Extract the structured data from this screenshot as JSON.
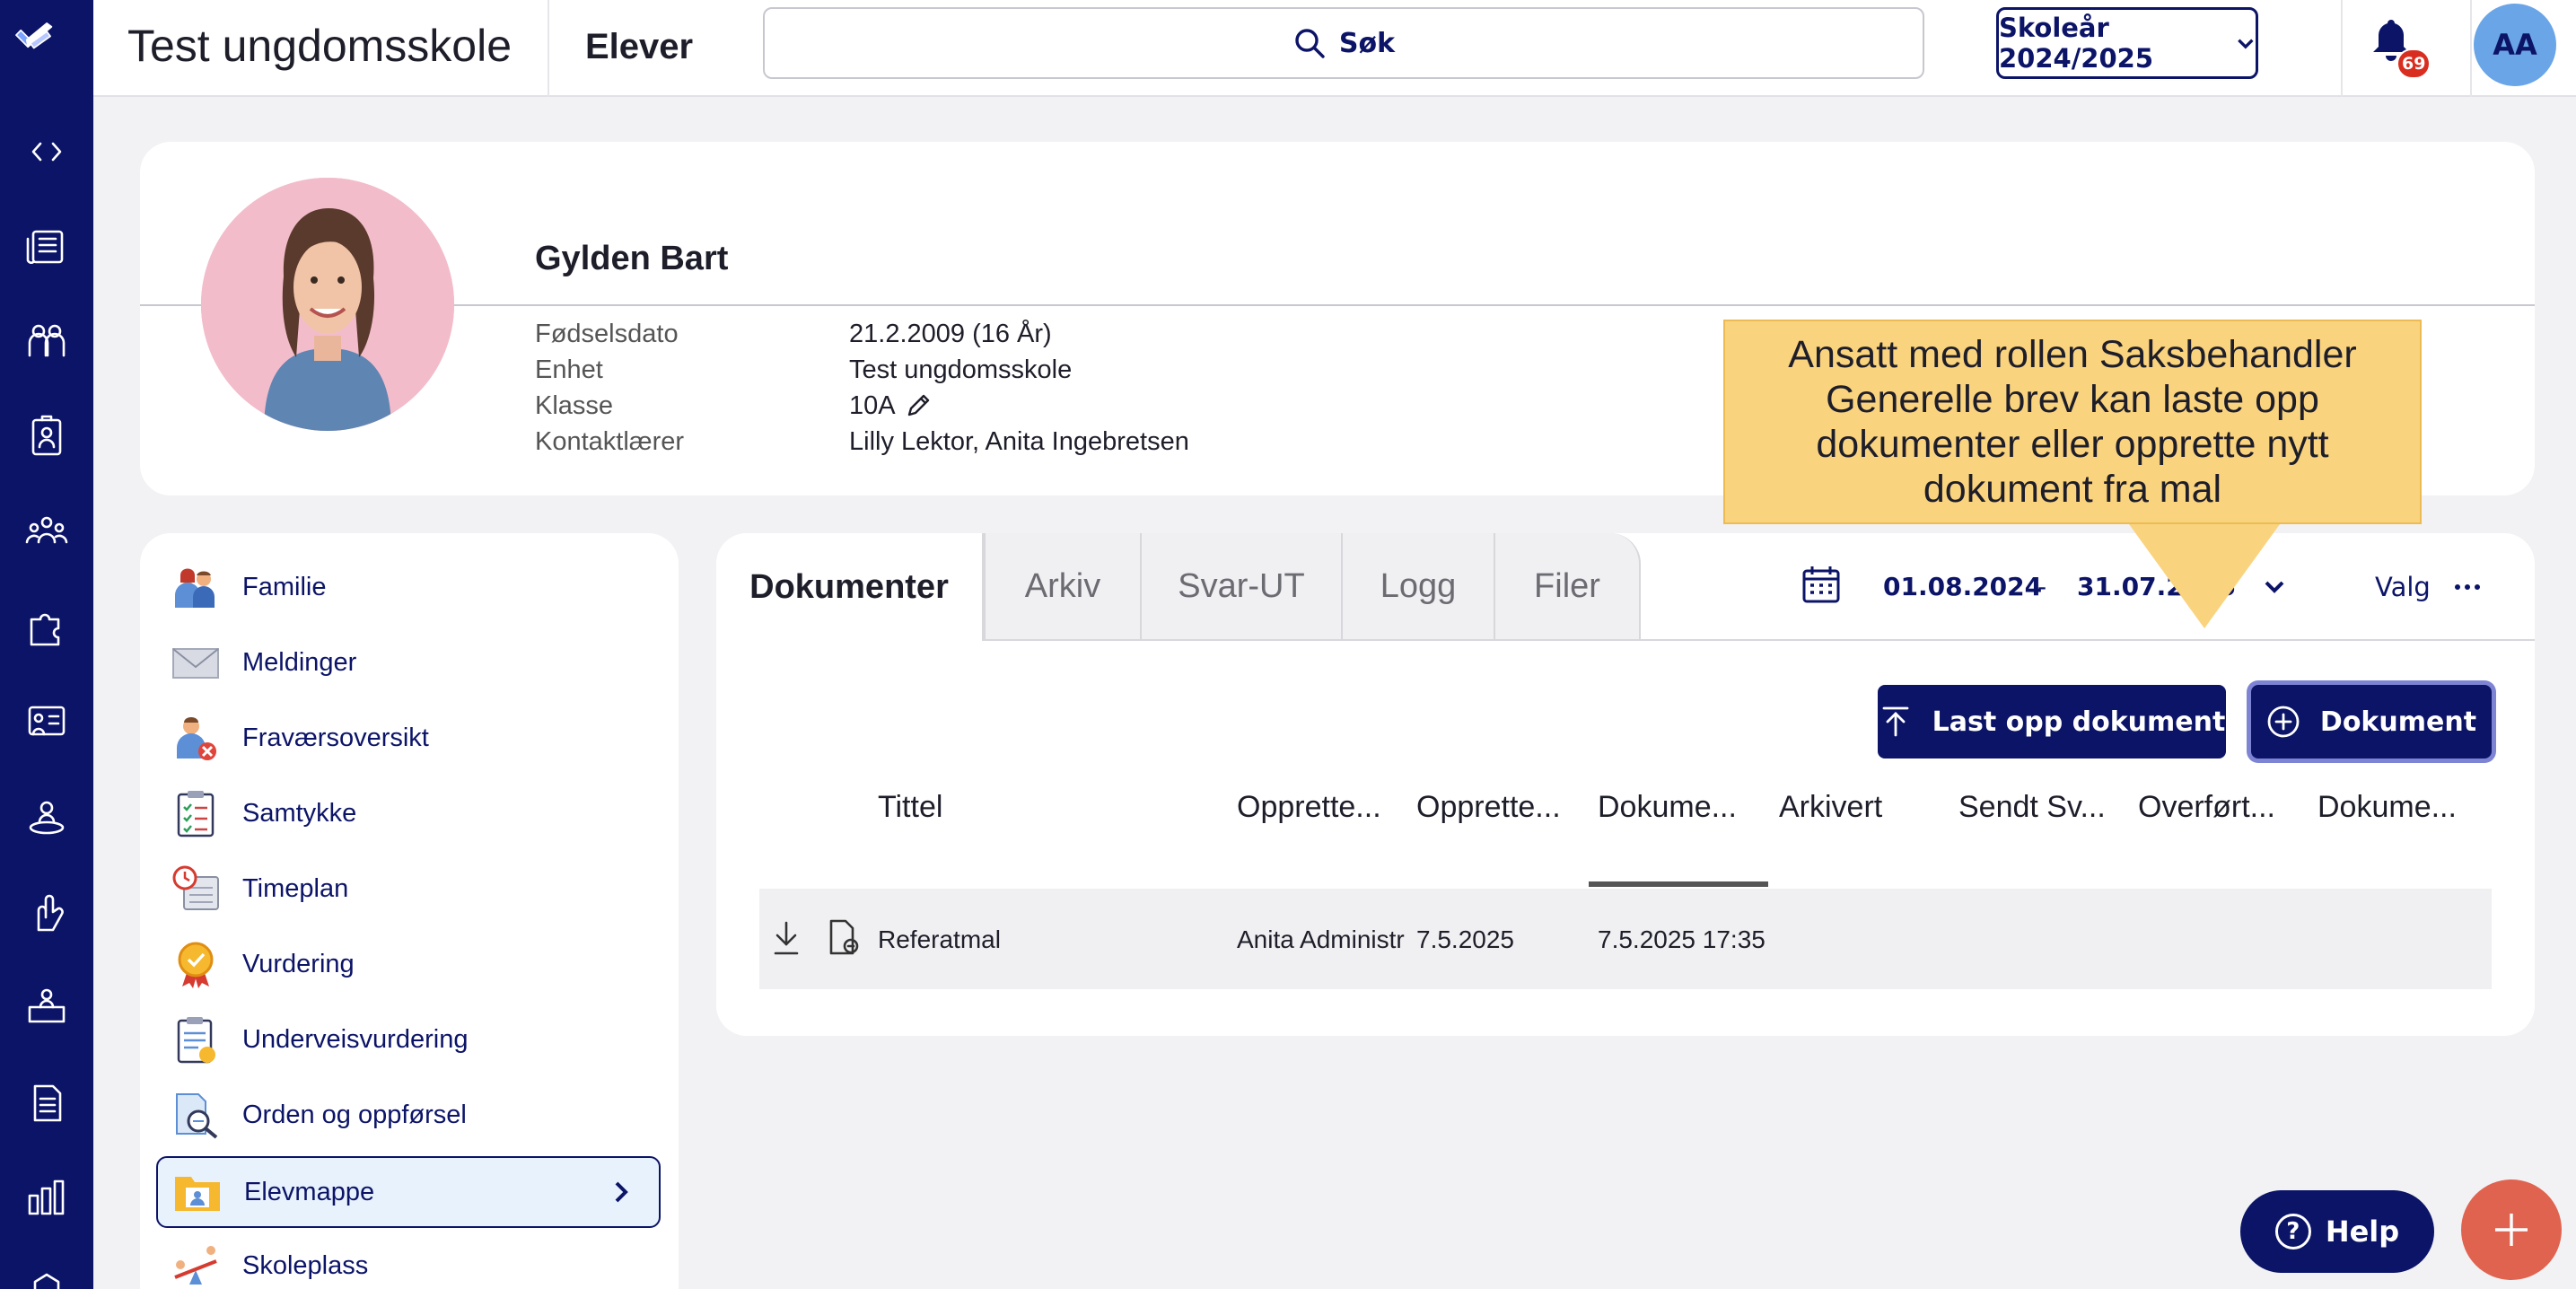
{
  "topbar": {
    "school_name": "Test ungdomsskole",
    "section_title": "Elever",
    "search_label": "Søk",
    "school_year": "Skoleår 2024/2025",
    "notification_count": "69",
    "user_initials": "AA"
  },
  "rail": {
    "icons": [
      "logo-icon",
      "expand-icon",
      "news-icon",
      "students-icon",
      "badge-icon",
      "groups-icon",
      "puzzle-icon",
      "chalkboard-icon",
      "location-icon",
      "hand-icon",
      "desk-icon",
      "document-icon",
      "chart-icon",
      "settings-icon"
    ]
  },
  "student": {
    "name": "Gylden Bart",
    "fields": [
      {
        "label": "Fødselsdato",
        "value": "21.2.2009 (16 År)"
      },
      {
        "label": "Enhet",
        "value": "Test ungdomsskole"
      },
      {
        "label": "Klasse",
        "value": "10A"
      },
      {
        "label": "Kontaktlærer",
        "value": "Lilly Lektor, Anita Ingebretsen"
      }
    ]
  },
  "callout": {
    "text": "Ansatt med rollen Saksbehandler Generelle brev kan laste opp dokumenter eller opprette nytt dokument fra mal"
  },
  "leftnav": {
    "items": [
      {
        "label": "Familie",
        "icon": "family-icon"
      },
      {
        "label": "Meldinger",
        "icon": "envelope-icon"
      },
      {
        "label": "Fraværsoversikt",
        "icon": "absence-icon"
      },
      {
        "label": "Samtykke",
        "icon": "consent-clipboard-icon"
      },
      {
        "label": "Timeplan",
        "icon": "schedule-icon"
      },
      {
        "label": "Vurdering",
        "icon": "medal-icon"
      },
      {
        "label": "Underveisvurdering",
        "icon": "assessment-clipboard-icon"
      },
      {
        "label": "Orden og oppførsel",
        "icon": "conduct-magnifier-icon"
      },
      {
        "label": "Elevmappe",
        "icon": "student-folder-icon",
        "active": true
      },
      {
        "label": "Skoleplass",
        "icon": "seesaw-icon"
      }
    ]
  },
  "documents": {
    "tabs": [
      "Dokumenter",
      "Arkiv",
      "Svar-UT",
      "Logg",
      "Filer"
    ],
    "active_tab": "Dokumenter",
    "date_from": "01.08.2024",
    "date_separator": "-",
    "date_to": "31.07.2025",
    "options_label": "Valg",
    "upload_button": "Last opp dokument",
    "new_document_button": "Dokument",
    "columns": [
      "Tittel",
      "Opprette...",
      "Opprette...",
      "Dokume...",
      "Arkivert",
      "Sendt Sv...",
      "Overført...",
      "Dokume..."
    ],
    "rows": [
      {
        "title": "Referatmal",
        "created_by": "Anita Administr",
        "created_date": "7.5.2025",
        "document_date": "7.5.2025 17:35",
        "archived": "",
        "sent": "",
        "transferred": "",
        "doc": ""
      }
    ]
  },
  "help_label": "Help",
  "colors": {
    "navy": "#0c1468",
    "callout": "#fad37e",
    "fab": "#e0634f",
    "active_nav_bg": "#e8f2fc"
  }
}
